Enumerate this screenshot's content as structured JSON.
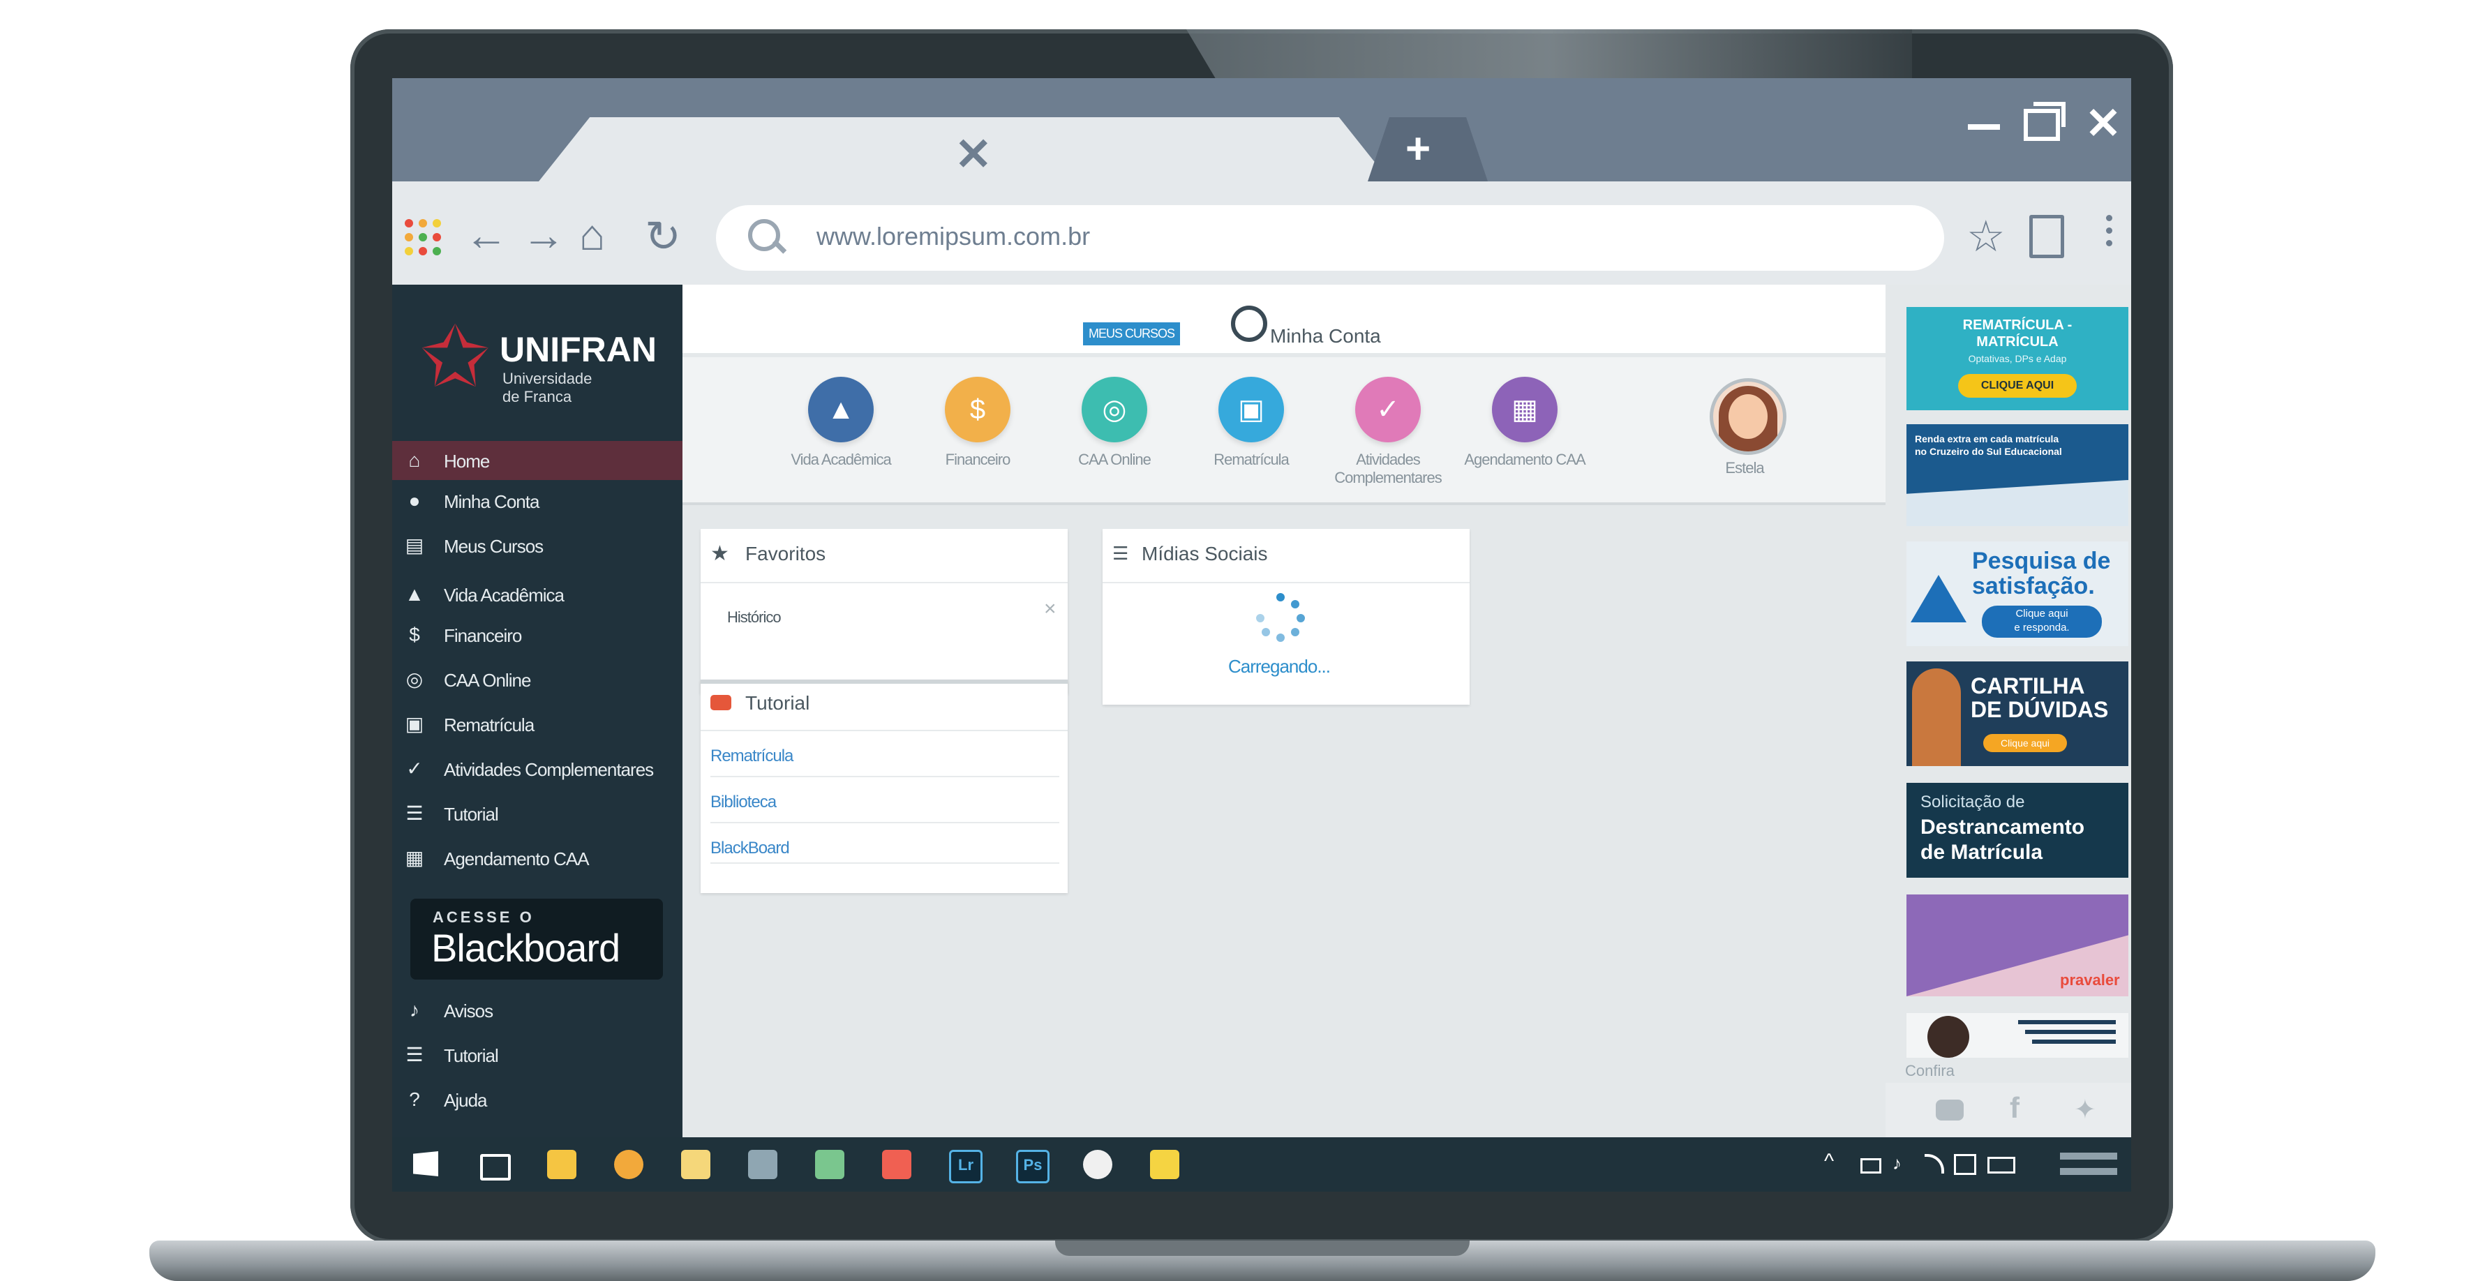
{
  "browser": {
    "url": "www.loremipsum.com.br",
    "tab_close": "✕",
    "new_tab": "+",
    "window_close": "✕"
  },
  "sidebar": {
    "brand": "UNIFRAN",
    "brand_sub_1": "Universidade",
    "brand_sub_2": "de Franca",
    "items": [
      {
        "label": "Home",
        "icon": "home-icon"
      },
      {
        "label": "Minha Conta",
        "icon": "user-icon"
      },
      {
        "label": "Meus Cursos",
        "icon": "book-icon"
      },
      {
        "label": "Vida Acadêmica",
        "icon": "graduation-cap-icon"
      },
      {
        "label": "Financeiro",
        "icon": "dollar-icon"
      },
      {
        "label": "CAA Online",
        "icon": "headset-icon"
      },
      {
        "label": "Rematrícula",
        "icon": "id-card-icon"
      },
      {
        "label": "Atividades Complementares",
        "icon": "check-circle-icon"
      },
      {
        "label": "Tutorial",
        "icon": "signpost-icon"
      },
      {
        "label": "Agendamento CAA",
        "icon": "calendar-icon"
      }
    ],
    "blackboard_top": "ACESSE O",
    "blackboard_name": "Blackboard",
    "bottom_items": [
      {
        "label": "Avisos",
        "icon": "bell-icon"
      },
      {
        "label": "Tutorial",
        "icon": "signpost-icon"
      },
      {
        "label": "Ajuda",
        "icon": "question-icon"
      }
    ]
  },
  "header": {
    "badge": "MEUS CURSOS",
    "account": "Minha Conta"
  },
  "shortcuts": [
    {
      "label": "Vida Acadêmica",
      "color": "#3f6ea8",
      "glyph": "🎓"
    },
    {
      "label": "Financeiro",
      "color": "#f2b04a",
      "glyph": "$"
    },
    {
      "label": "CAA Online",
      "color": "#3dbdb0",
      "glyph": "◎"
    },
    {
      "label": "Rematrícula",
      "color": "#36a9dc",
      "glyph": "▣"
    },
    {
      "label": "Atividades Complementares",
      "color": "#e07ab8",
      "glyph": "✓"
    },
    {
      "label": "Agendamento CAA",
      "color": "#8d63b8",
      "glyph": "▦"
    }
  ],
  "user": {
    "name": "Estela"
  },
  "favoritos": {
    "title": "Favoritos",
    "items": [
      "Histórico"
    ],
    "remove": "×"
  },
  "tutorial": {
    "title": "Tutorial",
    "links": [
      "Rematrícula",
      "Biblioteca",
      "BlackBoard"
    ]
  },
  "midias": {
    "title": "Mídias Sociais",
    "status": "Carregando..."
  },
  "banners": {
    "rematricula_title_1": "REMATRÍCULA -",
    "rematricula_title_2": "MATRÍCULA",
    "rematricula_sub": "Optativas, DPs e Adap",
    "rematricula_button": "CLIQUE AQUI",
    "renda_text_1": "Renda extra em cada matrícula",
    "renda_text_2": "no Cruzeiro do Sul Educacional",
    "pesquisa_title_1": "Pesquisa de",
    "pesquisa_title_2": "satisfação.",
    "pesquisa_button_1": "Clique aqui",
    "pesquisa_button_2": "e responda.",
    "cartilha_title_1": "CARTILHA",
    "cartilha_title_2": "DE DÚVIDAS",
    "cartilha_button": "Clique aqui",
    "destranc_top": "Solicitação de",
    "destranc_title_1": "Destrancamento",
    "destranc_title_2": "de Matrícula",
    "pravaler": "pravaler",
    "confira": "Confira"
  },
  "colors": {
    "sidebar_bg": "#20323c",
    "sidebar_active": "#5e2f3c",
    "accent_blue": "#2d8ecb",
    "tabbar": "#6e7e90"
  }
}
